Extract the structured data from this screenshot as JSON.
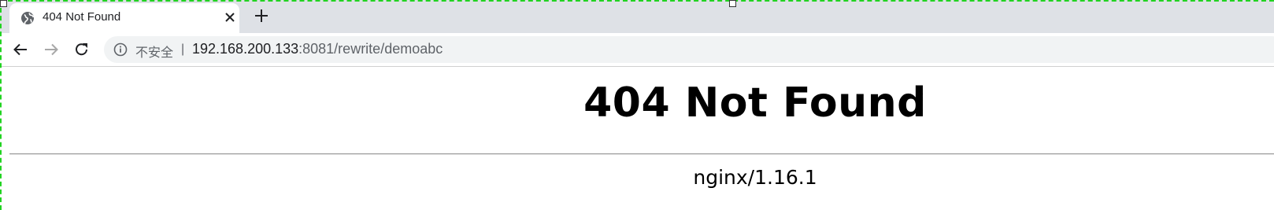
{
  "browser": {
    "tab": {
      "title": "404 Not Found",
      "favicon": "globe-icon",
      "close_icon": "close-icon"
    },
    "new_tab_icon": "plus-icon",
    "toolbar": {
      "back_icon": "back-arrow-icon",
      "forward_icon": "forward-arrow-icon",
      "reload_icon": "reload-icon"
    },
    "address_bar": {
      "security_icon": "info-icon",
      "security_label": "不安全",
      "separator": "|",
      "url_host": "192.168.200.133",
      "url_rest": ":8081/rewrite/demoabc"
    }
  },
  "page": {
    "heading": "404 Not Found",
    "server": "nginx/1.16.1"
  },
  "colors": {
    "tabstrip_bg": "#dee1e6",
    "omnibox_bg": "#f1f3f4",
    "selection_dash": "#21d321",
    "text_primary": "#202124",
    "text_secondary": "#5f6368"
  }
}
